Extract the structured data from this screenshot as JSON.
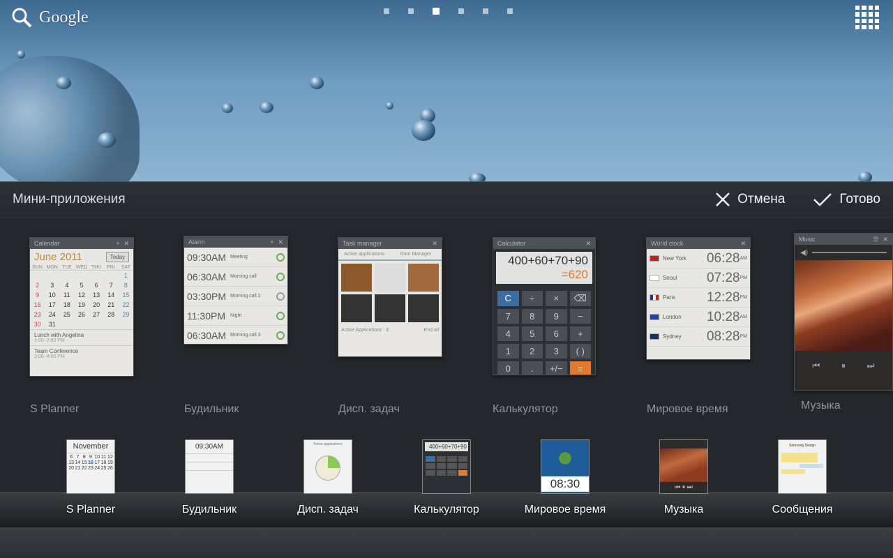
{
  "search": {
    "label": "Google"
  },
  "panel": {
    "title": "Мини-приложения",
    "cancel_label": "Отмена",
    "done_label": "Готово"
  },
  "widgets": [
    {
      "label": "S Planner",
      "bar": "Calendar"
    },
    {
      "label": "Будильник",
      "bar": "Alarm"
    },
    {
      "label": "Дисп. задач",
      "bar": "Task manager"
    },
    {
      "label": "Калькулятор",
      "bar": "Calculator"
    },
    {
      "label": "Мировое время",
      "bar": "World clock"
    },
    {
      "label": "Музыка",
      "bar": "Music"
    }
  ],
  "calendar": {
    "month": "June 2011",
    "today": "Today",
    "dow": [
      "SUN",
      "MON",
      "TUE",
      "WED",
      "THU",
      "FRI",
      "SAT"
    ],
    "events": [
      {
        "title": "Lunch with Angelina",
        "time": "1:00~2:00 PM"
      },
      {
        "title": "Team Conference",
        "time": "3:00~4:00 PM"
      }
    ]
  },
  "alarm": [
    {
      "time": "09:30AM",
      "name": "Meeting"
    },
    {
      "time": "06:30AM",
      "name": "Morning call"
    },
    {
      "time": "03:30PM",
      "name": "Morning call 2"
    },
    {
      "time": "11:30PM",
      "name": "Night"
    },
    {
      "time": "06:30AM",
      "name": "Morning call 3"
    }
  ],
  "taskmgr": {
    "tab1": "Active applications",
    "tab2": "Ram Manager",
    "footer": "Active Applications : 8",
    "end": "End all"
  },
  "calc": {
    "expr": "400+60+70+90",
    "result": "=620",
    "keys": [
      "C",
      "÷",
      "×",
      "⌫",
      "7",
      "8",
      "9",
      "−",
      "4",
      "5",
      "6",
      "+",
      "1",
      "2",
      "3",
      "( )",
      "0",
      ".",
      "+/−",
      "="
    ]
  },
  "worldclock": [
    {
      "city": "New York",
      "time": "06:28",
      "ampm": "AM"
    },
    {
      "city": "Seoul",
      "time": "07:28",
      "ampm": "PM"
    },
    {
      "city": "Paris",
      "time": "12:28",
      "ampm": "PM"
    },
    {
      "city": "London",
      "time": "10:28",
      "ampm": "AM"
    },
    {
      "city": "Sydney",
      "time": "08:28",
      "ampm": "PM"
    }
  ],
  "dock": [
    {
      "label": "S Planner",
      "icon": "November"
    },
    {
      "label": "Будильник",
      "icon": "09:30AM"
    },
    {
      "label": "Дисп. задач",
      "icon": "Active applications"
    },
    {
      "label": "Калькулятор",
      "icon": "400+60+70+90"
    },
    {
      "label": "Мировое время",
      "icon": "08:30"
    },
    {
      "label": "Музыка",
      "icon": ""
    },
    {
      "label": "Сообщения",
      "icon": "Samsung Design"
    }
  ],
  "colors": {
    "accent": "#e07a2e",
    "panel": "#24282d"
  }
}
